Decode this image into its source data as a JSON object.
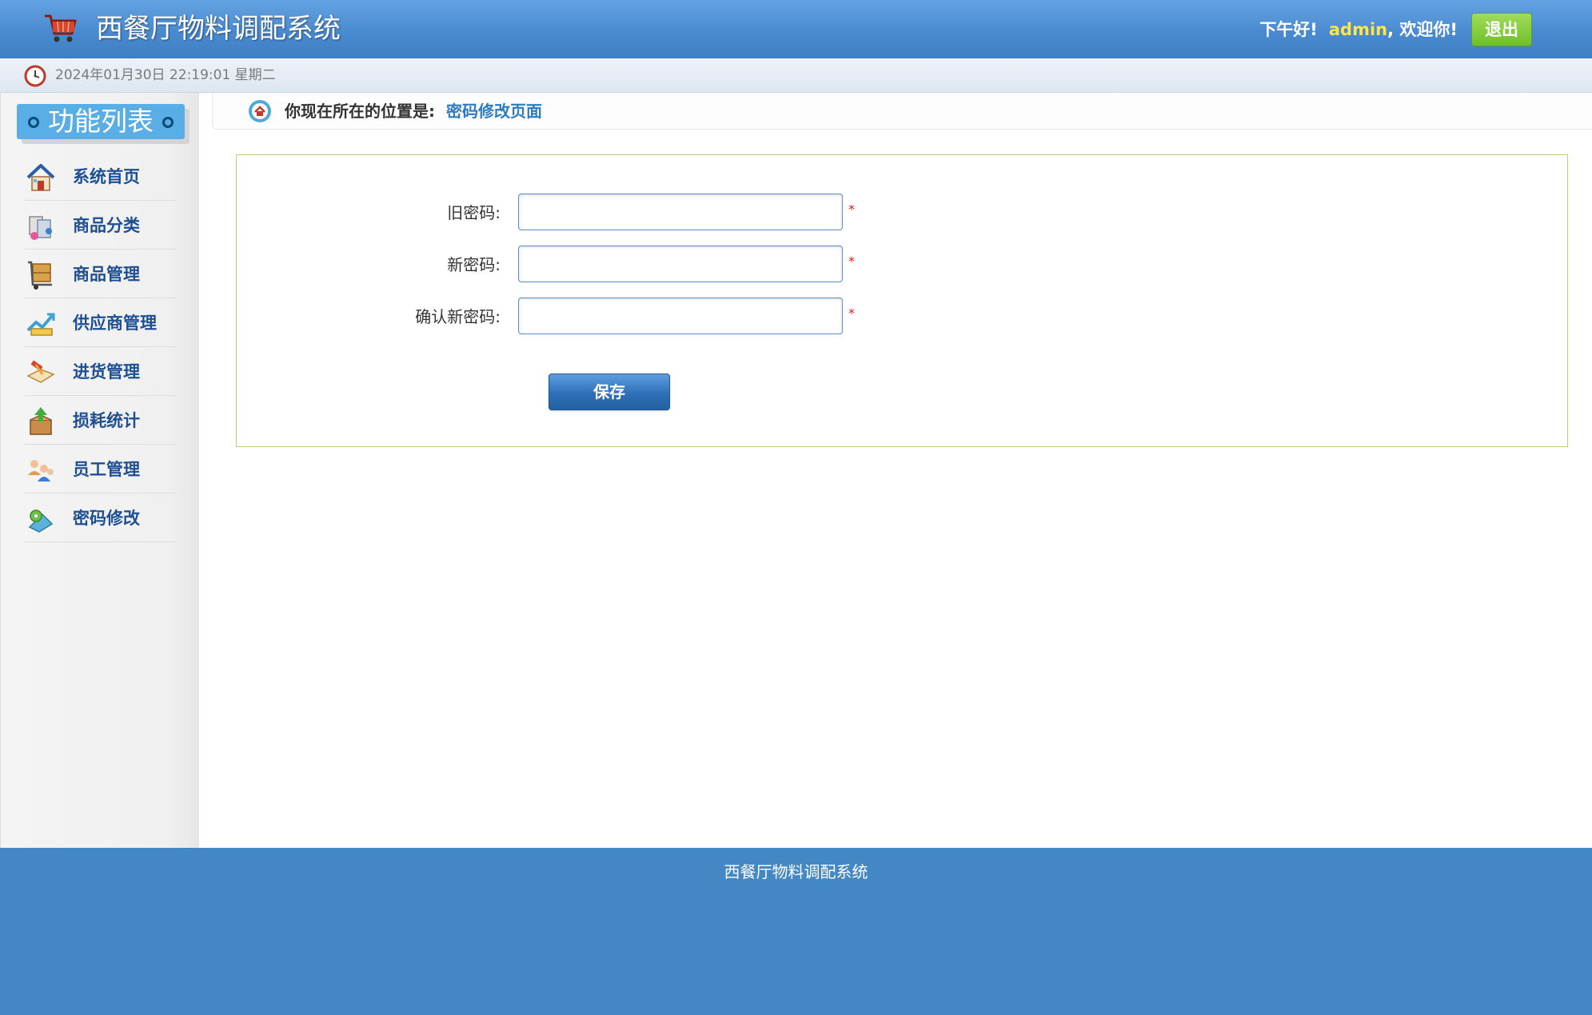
{
  "header": {
    "title": "西餐厅物料调配系统",
    "greeting": "下午好!",
    "username": "admin",
    "welcome": ", 欢迎你!",
    "logout_label": "退出"
  },
  "datebar": {
    "datetime": "2024年01月30日 22:19:01 星期二"
  },
  "sidebar": {
    "title": "功能列表",
    "items": [
      {
        "label": "系统首页",
        "icon": "home-icon"
      },
      {
        "label": "商品分类",
        "icon": "category-icon"
      },
      {
        "label": "商品管理",
        "icon": "goods-cart-icon"
      },
      {
        "label": "供应商管理",
        "icon": "supplier-icon"
      },
      {
        "label": "进货管理",
        "icon": "purchase-icon"
      },
      {
        "label": "损耗统计",
        "icon": "loss-box-icon"
      },
      {
        "label": "员工管理",
        "icon": "staff-icon"
      },
      {
        "label": "密码修改",
        "icon": "password-icon"
      }
    ]
  },
  "breadcrumb": {
    "prefix": "你现在所在的位置是:",
    "page": "密码修改页面"
  },
  "form": {
    "old_password_label": "旧密码:",
    "new_password_label": "新密码:",
    "confirm_password_label": "确认新密码:",
    "required_mark": "*",
    "save_label": "保存"
  },
  "footer": {
    "text": "西餐厅物料调配系统"
  },
  "colors": {
    "header_blue": "#4a8ad0",
    "footer_blue": "#4387c4",
    "username_yellow": "#ffe54a",
    "logout_green": "#7cc735",
    "menu_text": "#1e4f93",
    "breadcrumb_link": "#2d7cc1",
    "form_border": "#b7d27a",
    "required_red": "#e02020"
  }
}
